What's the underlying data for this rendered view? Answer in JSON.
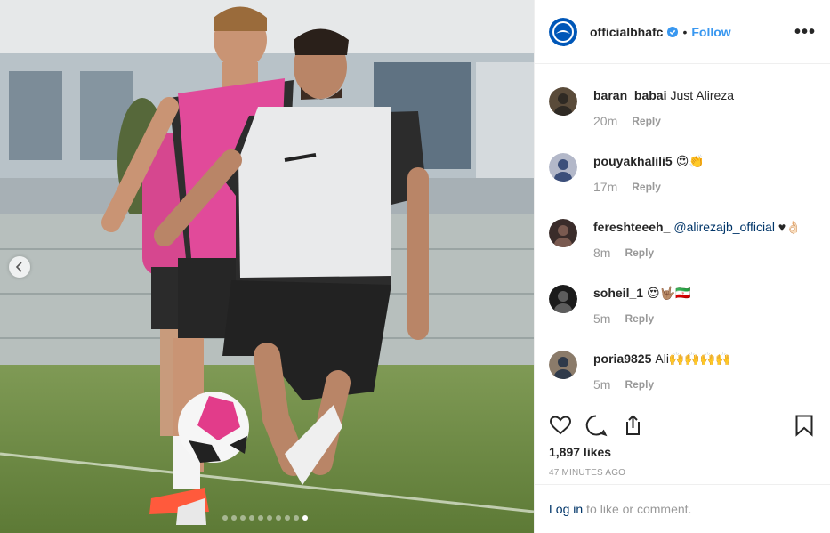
{
  "post": {
    "username": "officialbhafc",
    "separator": "•",
    "follow_label": "Follow",
    "more_label": "•••",
    "slide_count": 10,
    "active_slide": 9
  },
  "comments": [
    {
      "user": "baran_babai",
      "text": "Just Alireza",
      "mention": "",
      "tail": "",
      "time": "20m",
      "reply": "Reply"
    },
    {
      "user": "pouyakhalili5",
      "text": "😍👏",
      "mention": "",
      "tail": "",
      "time": "17m",
      "reply": "Reply"
    },
    {
      "user": "fereshteeeh_",
      "text": "",
      "mention": "@alirezajb_official",
      "tail": " ♥👌🏻",
      "time": "8m",
      "reply": "Reply"
    },
    {
      "user": "soheil_1",
      "text": "😍🤟🏽🇮🇷",
      "mention": "",
      "tail": "",
      "time": "5m",
      "reply": "Reply"
    },
    {
      "user": "poria9825",
      "text": "Ali🙌🙌🙌🙌",
      "mention": "",
      "tail": "",
      "time": "5m",
      "reply": "Reply"
    }
  ],
  "actions": {
    "likes": "1,897 likes",
    "time_ago": "47 MINUTES AGO"
  },
  "login": {
    "link": "Log in",
    "rest": "to like or comment."
  },
  "colors": {
    "link_blue": "#3897f0",
    "mention_blue": "#003569",
    "muted": "#999999"
  },
  "icons": [
    "chevron-left-icon",
    "verified-badge-icon",
    "heart-icon",
    "comment-icon",
    "share-icon",
    "bookmark-icon"
  ]
}
